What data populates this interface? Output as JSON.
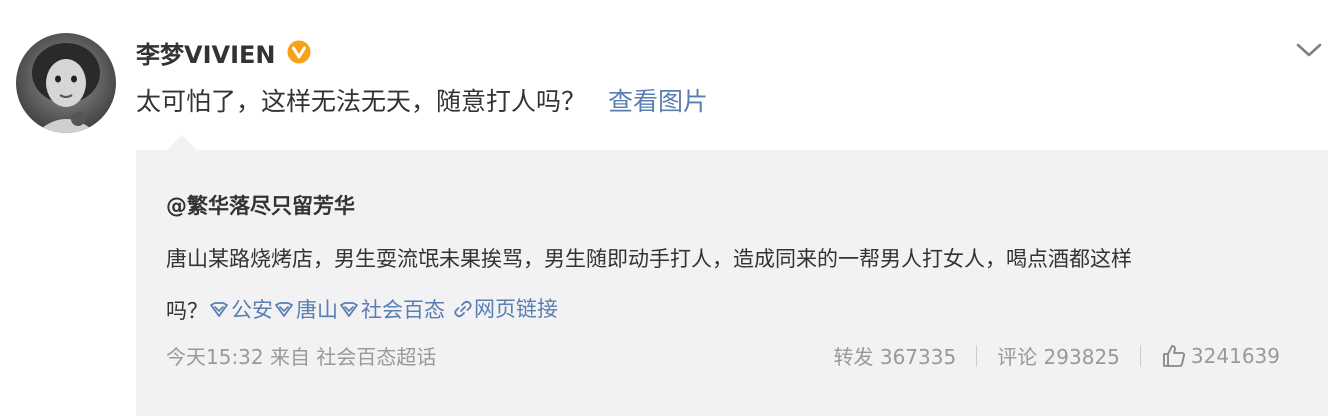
{
  "post": {
    "author": "李梦VIVIEN",
    "text": "太可怕了，这样无法无天，随意打人吗？",
    "view_images": "查看图片"
  },
  "repost": {
    "author": "@繁华落尽只留芳华",
    "line1": "唐山某路烧烤店，男生耍流氓未果挨骂，男生随即动手打人，造成同来的一帮男人打女人，喝点酒都这样",
    "line2_prefix": "吗？",
    "tags": [
      "公安",
      "唐山",
      "社会百态"
    ],
    "link": "网页链接",
    "time_source": "今天15:32 来自 社会百态超话",
    "repost_label": "转发 367335",
    "comment_label": "评论 293825",
    "like_count": "3241639"
  },
  "icons": {
    "verified": "verified-badge-icon",
    "expand": "chevron-down-icon",
    "topic": "super-topic-icon",
    "link": "link-icon",
    "like": "thumbs-up-icon"
  },
  "colors": {
    "link": "#5b7eb0",
    "verified": "#f7a21b",
    "repost_bg": "#f2f2f5",
    "meta_text": "#999999"
  }
}
